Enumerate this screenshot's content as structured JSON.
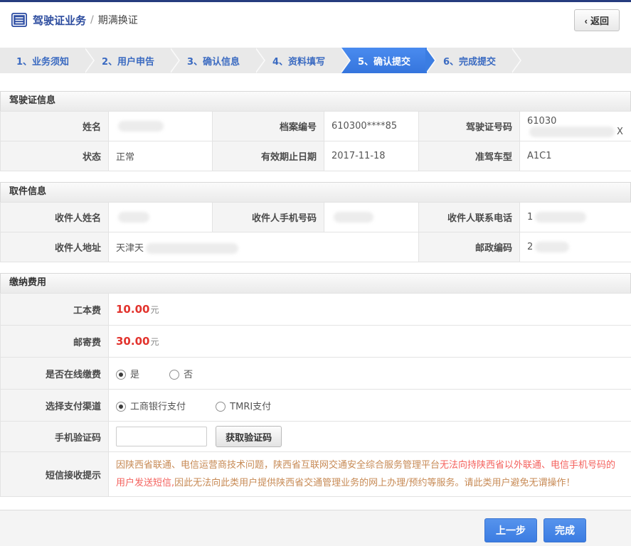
{
  "colors": {
    "navy": "#263c7e",
    "accent": "#3b7de2",
    "fee_red": "#e2332d",
    "notice_tan": "#c78a55",
    "notice_red": "#f4625e"
  },
  "header": {
    "title": "驾驶证业务",
    "separator": "/",
    "subtitle": "期满换证",
    "back_chevron": "‹",
    "back_label": "返回"
  },
  "steps": {
    "active_index": 4,
    "items": [
      {
        "label": "1、业务须知"
      },
      {
        "label": "2、用户申告"
      },
      {
        "label": "3、确认信息"
      },
      {
        "label": "4、资料填写"
      },
      {
        "label": "5、确认提交"
      },
      {
        "label": "6、完成提交"
      }
    ]
  },
  "license": {
    "title": "驾驶证信息",
    "name_label": "姓名",
    "file_label": "档案编号",
    "file_value": "610300****85",
    "licno_label": "驾驶证号码",
    "licno_prefix": "61030",
    "licno_suffix": "X",
    "status_label": "状态",
    "status_value": "正常",
    "expiry_label": "有效期止日期",
    "expiry_value": "2017-11-18",
    "vehicle_label": "准驾车型",
    "vehicle_value": "A1C1"
  },
  "pickup": {
    "title": "取件信息",
    "recipient_label": "收件人姓名",
    "mobile_label": "收件人手机号码",
    "phone_label": "收件人联系电话",
    "phone_prefix": "1",
    "address_label": "收件人地址",
    "address_prefix": "天津天",
    "zip_label": "邮政编码",
    "zip_prefix": "2"
  },
  "fees": {
    "title": "缴纳费用",
    "cost_label": "工本费",
    "cost_value": "10.00",
    "cost_unit": "元",
    "postage_label": "邮寄费",
    "postage_value": "30.00",
    "postage_unit": "元",
    "online_label": "是否在线缴费",
    "online_yes": "是",
    "online_no": "否",
    "channel_label": "选择支付渠道",
    "channel_icbc": "工商银行支付",
    "channel_tmri": "TMRI支付",
    "code_label": "手机验证码",
    "code_value": "",
    "code_button": "获取验证码",
    "notice_label": "短信接收提示",
    "notice_part1": "因陕西省联通、电信运营商技术问题，陕西省互联网交通安全综合服务管理平台",
    "notice_part2": "无法向持陕西省以外联通、电信手机号码的用户发送短信,",
    "notice_part3": "因此无法向此类用户提供陕西省交通管理业务的网上办理/预约等服务。请此类用户避免无谓操作！"
  },
  "actions": {
    "prev_label": "上一步",
    "finish_label": "完成"
  }
}
